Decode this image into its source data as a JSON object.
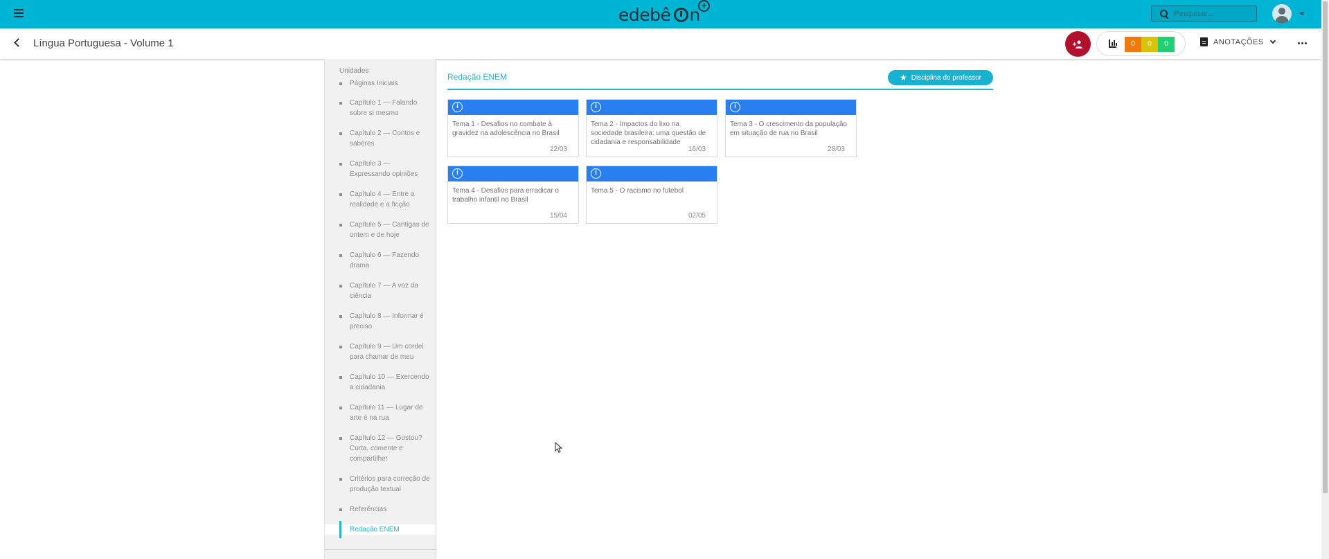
{
  "topbar": {
    "logo_text": "edebê",
    "logo_suffix": "n",
    "logo_plus": "+",
    "search_placeholder": "Pesquisar..."
  },
  "subbar": {
    "title": "Língua Portuguesa - Volume 1",
    "stats": [
      "0",
      "0",
      "0"
    ],
    "stat_colors": [
      "#f07a10",
      "#d7c20c",
      "#1fcf72"
    ],
    "notes_label": "ANOTAÇÕES"
  },
  "sidebar": {
    "heading": "Unidades",
    "items": [
      {
        "label": "Páginas Iniciais"
      },
      {
        "label": "Capítulo 1 — Falando sobre si mesmo"
      },
      {
        "label": "Capítulo 2 — Contos e saberes"
      },
      {
        "label": "Capítulo 3 — Expressando opiniões"
      },
      {
        "label": "Capítulo 4 — Entre a realidade e a ficção"
      },
      {
        "label": "Capítulo 5 — Cantigas de ontem e de hoje"
      },
      {
        "label": "Capítulo 6 — Fazendo drama"
      },
      {
        "label": "Capítulo 7 — A voz da ciência"
      },
      {
        "label": "Capítulo 8 — Informar é preciso"
      },
      {
        "label": "Capítulo 9 — Um cordel para chamar de meu"
      },
      {
        "label": "Capítulo 10 — Exercendo a cidadania"
      },
      {
        "label": "Capítulo 11 — Lugar de arte é na rua"
      },
      {
        "label": "Capítulo 12 — Gostou? Curta, comente e compartilhe!"
      },
      {
        "label": "Critérios para correção de produção textual"
      },
      {
        "label": "Referências"
      },
      {
        "label": "Redação ENEM"
      }
    ],
    "active_index": 15
  },
  "main": {
    "section_title": "Redação ENEM",
    "professor_button": "Disciplina do professor",
    "cards": [
      {
        "title": "Tema 1 - Desafios no combate à gravidez na adolescência no Brasil",
        "date": "22/03"
      },
      {
        "title": "Tema 2 - Impactos do lixo na sociedade brasileira: uma questão de cidadania e responsabilidade",
        "date": "16/03"
      },
      {
        "title": "Tema 3 - O crescimento da população em situação de rua no Brasil",
        "date": "28/03"
      },
      {
        "title": "Tema 4 - Desafios para erradicar o trabalho infantil no Brasil",
        "date": "15/04"
      },
      {
        "title": "Tema 5 - O racismo no futebol",
        "date": "02/05"
      }
    ]
  },
  "colors": {
    "brand": "#00b5d3",
    "card_header": "#2a7ff0",
    "class_button": "#b2102c"
  }
}
